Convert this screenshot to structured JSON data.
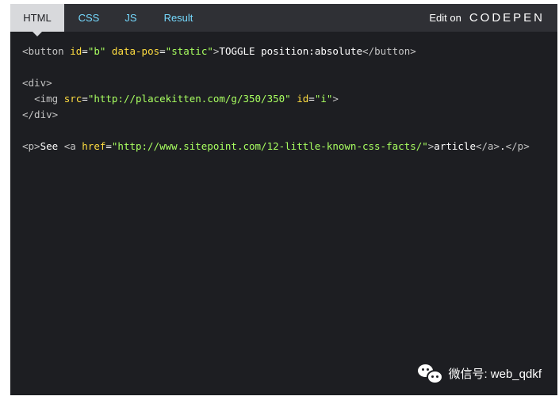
{
  "tabs": [
    {
      "label": "HTML",
      "active": true
    },
    {
      "label": "CSS",
      "active": false
    },
    {
      "label": "JS",
      "active": false
    },
    {
      "label": "Result",
      "active": false
    }
  ],
  "edit_on": {
    "label": "Edit on",
    "brand": "CODEPEN"
  },
  "code_lines": [
    [
      {
        "c": "t",
        "v": "<button "
      },
      {
        "c": "a",
        "v": "id"
      },
      {
        "c": "p",
        "v": "="
      },
      {
        "c": "s",
        "v": "\"b\""
      },
      {
        "c": "p",
        "v": " "
      },
      {
        "c": "a",
        "v": "data-pos"
      },
      {
        "c": "p",
        "v": "="
      },
      {
        "c": "s",
        "v": "\"static\""
      },
      {
        "c": "t",
        "v": ">"
      },
      {
        "c": "p",
        "v": "TOGGLE position:absolute"
      },
      {
        "c": "t",
        "v": "</button>"
      }
    ],
    [],
    [
      {
        "c": "t",
        "v": "<div>"
      }
    ],
    [
      {
        "c": "p",
        "v": "  "
      },
      {
        "c": "t",
        "v": "<img "
      },
      {
        "c": "a",
        "v": "src"
      },
      {
        "c": "p",
        "v": "="
      },
      {
        "c": "s",
        "v": "\"http://placekitten.com/g/350/350\""
      },
      {
        "c": "p",
        "v": " "
      },
      {
        "c": "a",
        "v": "id"
      },
      {
        "c": "p",
        "v": "="
      },
      {
        "c": "s",
        "v": "\"i\""
      },
      {
        "c": "t",
        "v": ">"
      }
    ],
    [
      {
        "c": "t",
        "v": "</div>"
      }
    ],
    [],
    [
      {
        "c": "t",
        "v": "<p>"
      },
      {
        "c": "p",
        "v": "See "
      },
      {
        "c": "t",
        "v": "<a "
      },
      {
        "c": "a",
        "v": "href"
      },
      {
        "c": "p",
        "v": "="
      },
      {
        "c": "s",
        "v": "\"http://www.sitepoint.com/12-little-known-css-facts/\""
      },
      {
        "c": "t",
        "v": ">"
      },
      {
        "c": "p",
        "v": "article"
      },
      {
        "c": "t",
        "v": "</a>"
      },
      {
        "c": "p",
        "v": "."
      },
      {
        "c": "t",
        "v": "</p>"
      }
    ]
  ],
  "watermark": {
    "icon": "wechat-icon",
    "text": "微信号: web_qdkf"
  },
  "colors": {
    "background": "#1d1e22",
    "tabbar": "#2f3035",
    "active_tab": "#d8d9dc",
    "tab_text": "#76daff",
    "tag": "#c4c4c4",
    "attr": "#ffdd40",
    "string": "#a8ff60"
  }
}
